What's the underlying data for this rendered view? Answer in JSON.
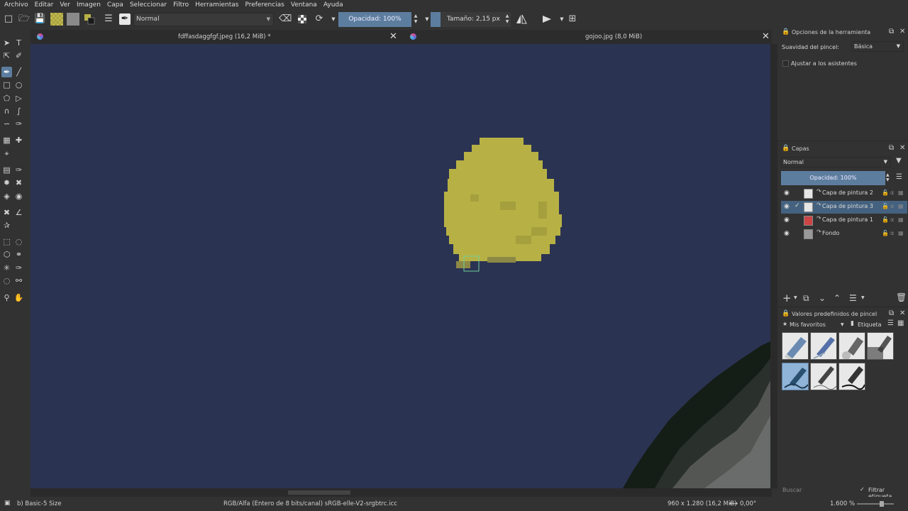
{
  "menu": [
    "Archivo",
    "Editar",
    "Ver",
    "Imagen",
    "Capa",
    "Seleccionar",
    "Filtro",
    "Herramientas",
    "Preferencias",
    "Ventana",
    "Ayuda"
  ],
  "toolbar": {
    "blend_mode": "Normal",
    "opacity_label": "Opacidad: 100%",
    "size_label": "Tamaño: 2,15 px",
    "colors": {
      "foreground": "#b8b044",
      "background": "#8a8a8a",
      "slider": "#5d7d9f"
    }
  },
  "tabs": [
    {
      "title": "fdffasdaggfgf.jpeg (16,2 MiB) *"
    },
    {
      "title": "gojoo.jpg (8,0 MiB)"
    }
  ],
  "canvas": {
    "background_color": "#2b3352",
    "blob_color": "#b7b145"
  },
  "tool_options": {
    "title": "Opciones de la herramienta",
    "smoothing_label": "Suavidad del pincel:",
    "smoothing_value": "Básica",
    "snap_label": "Ajustar a los asistentes"
  },
  "layers": {
    "title": "Capas",
    "blend_mode": "Normal",
    "opacity_label": "Opacidad:  100%",
    "items": [
      {
        "name": "Capa de pintura 2",
        "selected": false,
        "checked": false
      },
      {
        "name": "Capa de pintura 3",
        "selected": true,
        "checked": true
      },
      {
        "name": "Capa de pintura 1",
        "selected": false,
        "checked": false
      },
      {
        "name": "Fondo",
        "selected": false,
        "checked": false
      }
    ]
  },
  "presets": {
    "title": "Valores predefinidos de pincel",
    "favorites_label": "Mis favoritos",
    "tag_label": "Etiqueta",
    "search_placeholder": "Buscar",
    "filter_label": "Filtrar etiqueta"
  },
  "status": {
    "brush": "b) Basic-5 Size",
    "color_space": "RGB/Alfa (Entero de 8 bits/canal)  sRGB-elle-V2-srgbtrc.icc",
    "dimensions": "960 x 1.280 (16,2 MiB)",
    "rotation": "0,00°",
    "zoom": "1.600 %"
  }
}
